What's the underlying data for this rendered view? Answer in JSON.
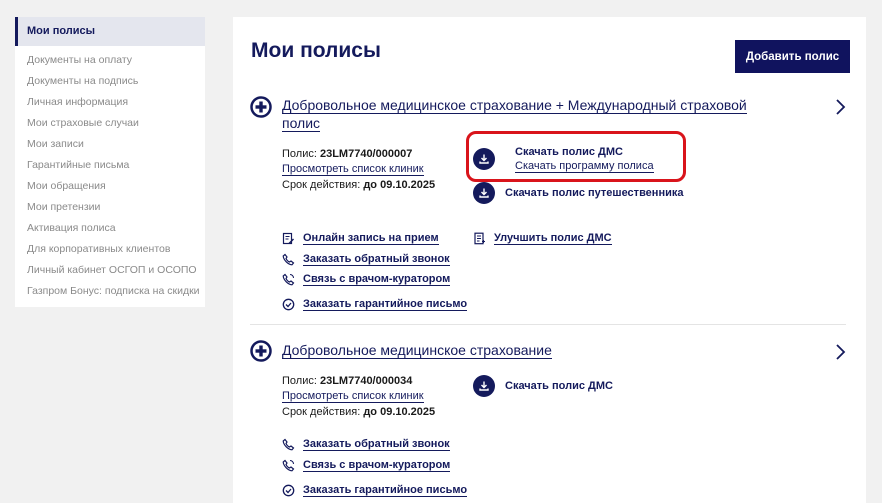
{
  "sidebar": {
    "active": "Мои полисы",
    "items": [
      "Документы на оплату",
      "Документы на подпись",
      "Личная информация",
      "Мои страховые случаи",
      "Мои записи",
      "Гарантийные письма",
      "Мои обращения",
      "Мои претензии",
      "Активация полиса",
      "Для корпоративных клиентов",
      "Личный кабинет ОСГОП и ОСОПО",
      "Газпром Бонус: подписка на скидки"
    ]
  },
  "main": {
    "title": "Мои полисы",
    "add_button": "Добавить полис"
  },
  "policies": [
    {
      "title_line1": "Добровольное медицинское страхование + Международный страховой",
      "title_line2": "полис",
      "number_label": "Полис: ",
      "number": "23LM7740/000007",
      "clinics_link": "Просмотреть список клиник",
      "validity_label": "Срок действия: ",
      "validity": "до 09.10.2025",
      "download_dms": "Скачать полис ДМС",
      "download_program": "Скачать программу полиса",
      "download_travel": "Скачать полис путешественника",
      "actions": {
        "online_booking": "Онлайн запись на прием",
        "callback": "Заказать обратный звонок",
        "curator": "Связь с врачом-куратором",
        "guarantee": "Заказать гарантийное письмо",
        "improve": "Улучшить полис ДМС"
      }
    },
    {
      "title": "Добровольное медицинское страхование",
      "number_label": "Полис: ",
      "number": "23LM7740/000034",
      "clinics_link": "Просмотреть список клиник",
      "validity_label": "Срок действия: ",
      "validity": "до 09.10.2025",
      "download_dms": "Скачать полис ДМС",
      "actions": {
        "callback": "Заказать обратный звонок",
        "curator": "Связь с врачом-куратором",
        "guarantee": "Заказать гарантийное письмо"
      }
    }
  ],
  "colors": {
    "brand_navy": "#141a5c",
    "highlight_red": "#d9141b",
    "sidebar_active_bg": "#e4e6ee"
  }
}
